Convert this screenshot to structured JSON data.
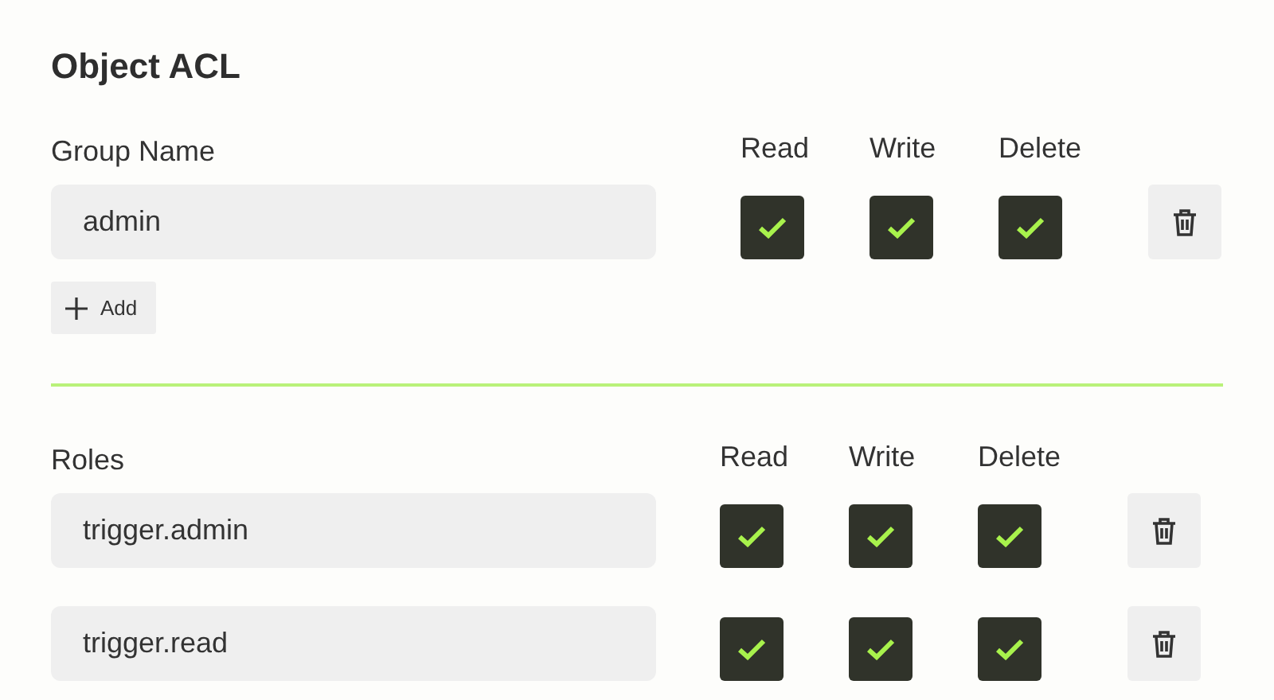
{
  "title": "Object ACL",
  "sections": [
    {
      "label": "Group Name",
      "columns": [
        "Read",
        "Write",
        "Delete"
      ],
      "rows": [
        {
          "value": "admin",
          "permissions": [
            {
              "checked": true
            },
            {
              "checked": true
            },
            {
              "checked": true
            }
          ]
        }
      ],
      "add_button": "Add"
    },
    {
      "label": "Roles",
      "columns": [
        "Read",
        "Write",
        "Delete"
      ],
      "rows": [
        {
          "value": "trigger.admin",
          "permissions": [
            {
              "checked": true
            },
            {
              "checked": true
            },
            {
              "checked": true
            }
          ]
        },
        {
          "value": "trigger.read",
          "permissions": [
            {
              "checked": true
            },
            {
              "checked": true
            },
            {
              "checked": true
            }
          ]
        }
      ]
    }
  ]
}
